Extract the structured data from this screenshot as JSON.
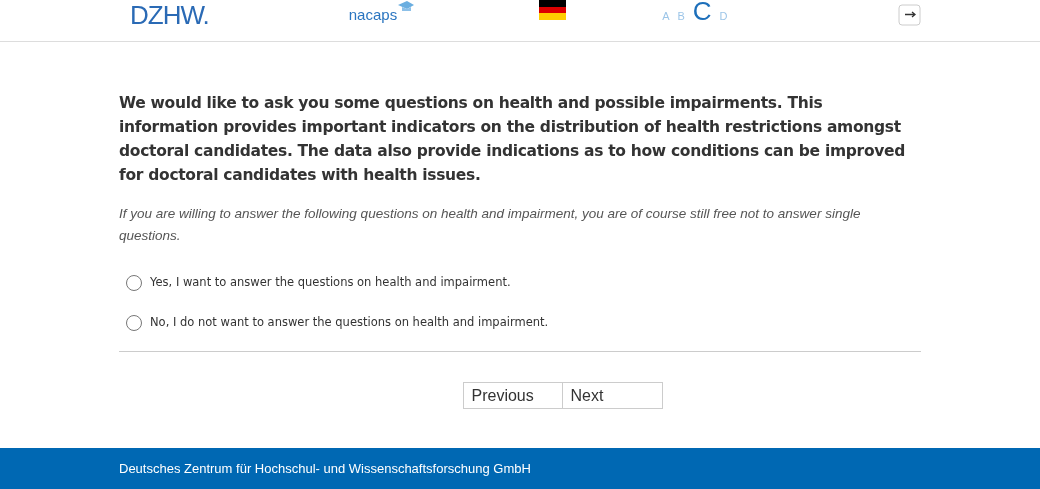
{
  "header": {
    "logo": "DZHW.",
    "brand": "nacaps",
    "font_sizes": [
      {
        "label": "A",
        "selected": false
      },
      {
        "label": "B",
        "selected": false
      },
      {
        "label": "C",
        "selected": true
      },
      {
        "label": "D",
        "selected": false
      }
    ]
  },
  "intro": "We would like to ask you some questions on health and possible impairments. This information provides important indicators on the distribution of health restrictions amongst doctoral candidates. The data also provide indications as to how conditions can be improved for doctoral candidates with health issues.",
  "note": "If you are willing to answer the following questions on health and impairment, you are of course still free not to answer single questions.",
  "options": [
    {
      "label": "Yes, I want to answer the questions on health and impairment.",
      "selected": false
    },
    {
      "label": "No, I do not want to answer the questions on health and impairment.",
      "selected": false
    }
  ],
  "buttons": [
    "Previous",
    "Next"
  ],
  "footer": "Deutsches Zentrum für Hochschul- und Wissenschaftsforschung GmbH"
}
